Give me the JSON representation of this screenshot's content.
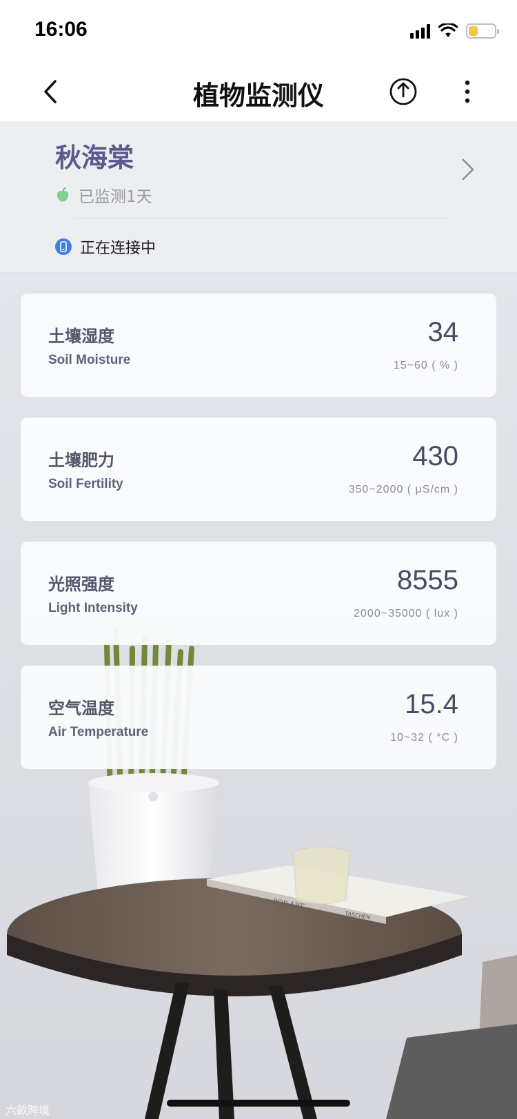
{
  "status_bar": {
    "time": "16:06",
    "icons": [
      "signal-icon",
      "wifi-icon",
      "battery-icon"
    ],
    "battery_level": 0.35,
    "battery_color": "#f2c744"
  },
  "nav": {
    "title": "植物监测仪",
    "icons": [
      "back-chevron-icon",
      "share-icon",
      "more-icon"
    ]
  },
  "plant": {
    "name": "秋海棠",
    "days_text": "已监测1天",
    "connection_text": "正在连接中",
    "icons": [
      "apple-icon",
      "chevron-right-icon",
      "phone-icon"
    ]
  },
  "metrics": [
    {
      "label_zh": "土壤湿度",
      "label_en": "Soil Moisture",
      "value": "34",
      "range": "15~60 ( % )"
    },
    {
      "label_zh": "土壤肥力",
      "label_en": "Soil Fertility",
      "value": "430",
      "range": "350~2000 ( μS/cm )"
    },
    {
      "label_zh": "光照强度",
      "label_en": "Light Intensity",
      "value": "8555",
      "range": "2000~35000 ( lux )"
    },
    {
      "label_zh": "空气温度",
      "label_en": "Air Temperature",
      "value": "15.4",
      "range": "10~32 ( °C )"
    }
  ],
  "scene": {
    "book_title": "POP ART",
    "book_publisher": "TASCHEN"
  },
  "watermark": "六畝跨境",
  "colors": {
    "accent": "#5d5a8c",
    "connection_blue": "#3d7fe6",
    "apple_green": "#7bd48f"
  }
}
